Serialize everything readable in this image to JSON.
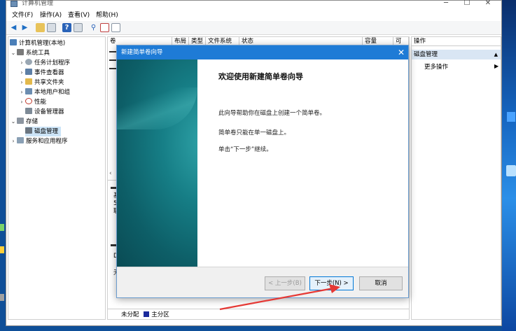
{
  "window": {
    "title": "计算机管理",
    "min": "─",
    "max": "☐",
    "close": "✕"
  },
  "menu": [
    "文件(F)",
    "操作(A)",
    "查看(V)",
    "帮助(H)"
  ],
  "tree": {
    "root": "计算机管理(本地)",
    "items": [
      {
        "label": "系统工具",
        "level": 1,
        "expanded": true
      },
      {
        "label": "任务计划程序",
        "level": 2
      },
      {
        "label": "事件查看器",
        "level": 2
      },
      {
        "label": "共享文件夹",
        "level": 2
      },
      {
        "label": "本地用户和组",
        "level": 2
      },
      {
        "label": "性能",
        "level": 2
      },
      {
        "label": "设备管理器",
        "level": 2
      },
      {
        "label": "存储",
        "level": 1,
        "expanded": true
      },
      {
        "label": "磁盘管理",
        "level": 2,
        "selected": true
      },
      {
        "label": "服务和应用程序",
        "level": 1
      }
    ]
  },
  "center": {
    "columns": [
      "卷",
      "布局",
      "类型",
      "文件系统",
      "状态",
      "容量",
      "可"
    ],
    "disk0": {
      "line1": "基",
      "line2": "59",
      "line3": "联"
    },
    "dvd": {
      "line1": "DV",
      "line2": "无"
    },
    "legend": {
      "unallocated": "未分配",
      "primary": "主分区"
    }
  },
  "actions": {
    "title": "操作",
    "section": "磁盘管理",
    "more": "更多操作"
  },
  "wizard": {
    "title": "新建简单卷向导",
    "close": "✕",
    "heading": "欢迎使用新建简单卷向导",
    "p1": "此向导帮助你在磁盘上创建一个简单卷。",
    "p2": "简单卷只能在单一磁盘上。",
    "p3": "单击“下一步”继续。",
    "back": "< 上一步(B)",
    "next": "下一步(N) >",
    "cancel": "取消"
  },
  "colors": {
    "title_blue": "#1e7bd6",
    "teal": "#167e86",
    "annotation": "#e53935"
  }
}
